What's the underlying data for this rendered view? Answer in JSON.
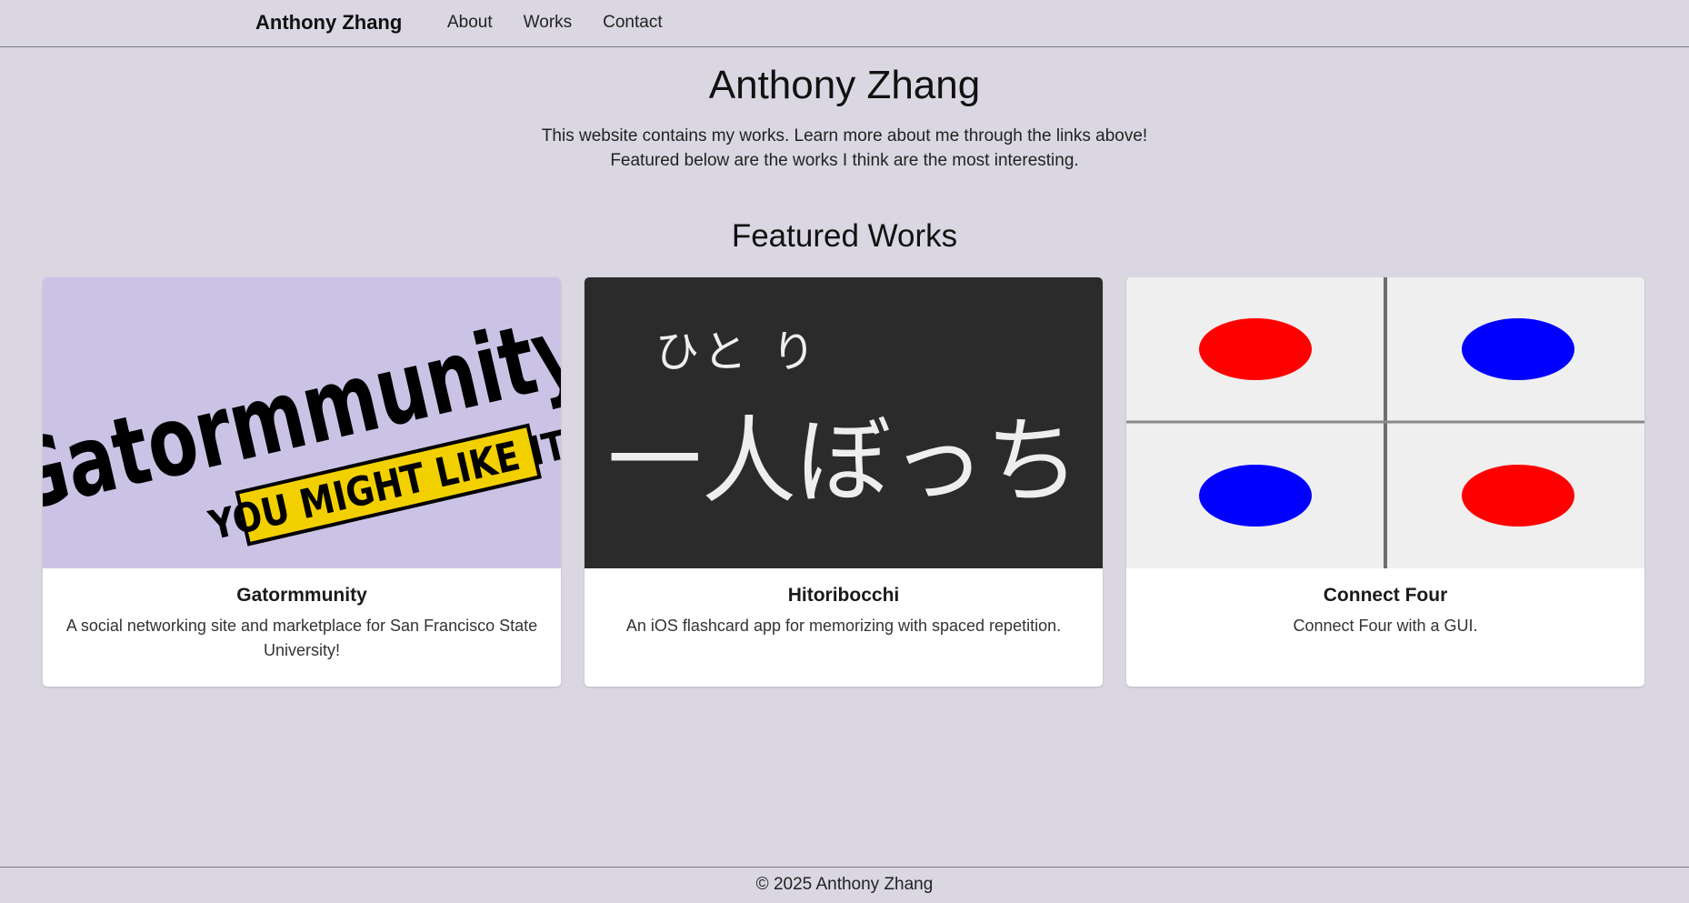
{
  "nav": {
    "brand": "Anthony Zhang",
    "links": [
      "About",
      "Works",
      "Contact"
    ]
  },
  "hero": {
    "title": "Anthony Zhang",
    "line1": "This website contains my works. Learn more about me through the links above!",
    "line2": "Featured below are the works I think are the most interesting."
  },
  "featured": {
    "title": "Featured Works",
    "cards": [
      {
        "title": "Gatormmunity",
        "text": "A social networking site and marketplace for San Francisco State University!",
        "image": {
          "logo": "Gatormmunity",
          "tagline": "YOU MIGHT LIKE IT",
          "bg": "#cbc3e6"
        }
      },
      {
        "title": "Hitoribocchi",
        "text": "An iOS flashcard app for memorizing with spaced repetition.",
        "image": {
          "furigana": "ひと り",
          "kanji": "一人ぼっち",
          "bg": "#2b2b2b"
        }
      },
      {
        "title": "Connect Four",
        "text": "Connect Four with a GUI.",
        "image": {
          "bg": "#efefef",
          "colors": [
            "#ff0000",
            "#0000ff",
            "#0000ff",
            "#ff0000"
          ]
        }
      }
    ]
  },
  "footer": {
    "text": "© 2025 Anthony Zhang"
  }
}
